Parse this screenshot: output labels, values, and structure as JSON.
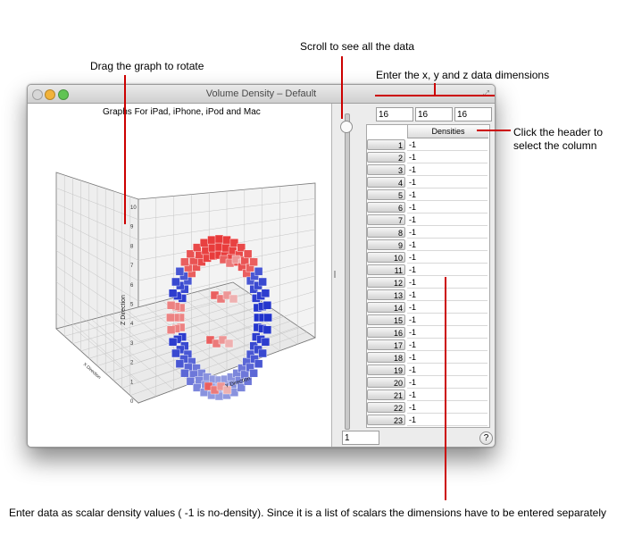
{
  "annotations": {
    "scroll": "Scroll to see all the data",
    "rotate": "Drag the graph to rotate",
    "dimensions": "Enter the x, y and z data dimensions",
    "header_line1": "Click the header to",
    "header_line2": "select the column",
    "footer": "Enter data as scalar density values ( -1 is no-density). Since it is a list of scalars the dimensions have to be entered separately"
  },
  "window": {
    "title": "Volume Density – Default",
    "graph_title": "Graphs For iPad, iPhone, iPod and Mac",
    "fullscreen_icon": "fullscreen-arrows-icon",
    "colors": {
      "negative": "#e83a3a",
      "positive": "#2233cc",
      "neutral": "#f1f1f1",
      "annotation": "#cc0000"
    }
  },
  "axes": {
    "z_label": "Z Direction",
    "y_label": "Y Direction",
    "x_label": "X Direction",
    "z_ticks": [
      "10",
      "9",
      "8",
      "7",
      "6",
      "5",
      "4",
      "3",
      "2",
      "1",
      "0"
    ]
  },
  "dimensions": {
    "x": "16",
    "y": "16",
    "z": "16"
  },
  "table": {
    "column_header": "Densities",
    "rows": [
      {
        "index": "1",
        "value": "-1"
      },
      {
        "index": "2",
        "value": "-1"
      },
      {
        "index": "3",
        "value": "-1"
      },
      {
        "index": "4",
        "value": "-1"
      },
      {
        "index": "5",
        "value": "-1"
      },
      {
        "index": "6",
        "value": "-1"
      },
      {
        "index": "7",
        "value": "-1"
      },
      {
        "index": "8",
        "value": "-1"
      },
      {
        "index": "9",
        "value": "-1"
      },
      {
        "index": "10",
        "value": "-1"
      },
      {
        "index": "11",
        "value": "-1"
      },
      {
        "index": "12",
        "value": "-1"
      },
      {
        "index": "13",
        "value": "-1"
      },
      {
        "index": "14",
        "value": "-1"
      },
      {
        "index": "15",
        "value": "-1"
      },
      {
        "index": "16",
        "value": "-1"
      },
      {
        "index": "17",
        "value": "-1"
      },
      {
        "index": "18",
        "value": "-1"
      },
      {
        "index": "19",
        "value": "-1"
      },
      {
        "index": "20",
        "value": "-1"
      },
      {
        "index": "21",
        "value": "-1"
      },
      {
        "index": "22",
        "value": "-1"
      },
      {
        "index": "23",
        "value": "-1"
      }
    ]
  },
  "bottom_input_value": "1",
  "help_label": "?"
}
